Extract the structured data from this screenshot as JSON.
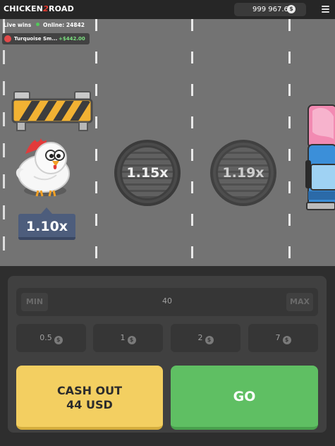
{
  "header": {
    "logo_left": "CHICKEN",
    "logo_mid": "2",
    "logo_right": "ROAD",
    "balance": "999 967.6",
    "currency_symbol": "$"
  },
  "live": {
    "label": "Live wins",
    "online": "Online: 24842",
    "latest_win": {
      "name": "Turquoise Sm...",
      "amount": "+$442.00"
    }
  },
  "road": {
    "current_multiplier": "1.10x",
    "next_multipliers": [
      "1.15x",
      "1.19x"
    ]
  },
  "controls": {
    "min_label": "MIN",
    "max_label": "MAX",
    "bet_value": "40",
    "quick_bets": [
      "0.5",
      "1",
      "2",
      "7"
    ],
    "cashout_line1": "CASH OUT",
    "cashout_line2": "44 USD",
    "go_label": "GO"
  },
  "colors": {
    "cashout": "#f3cf61",
    "go": "#5fbf63",
    "multiplier_tag": "#4d5d7c"
  }
}
